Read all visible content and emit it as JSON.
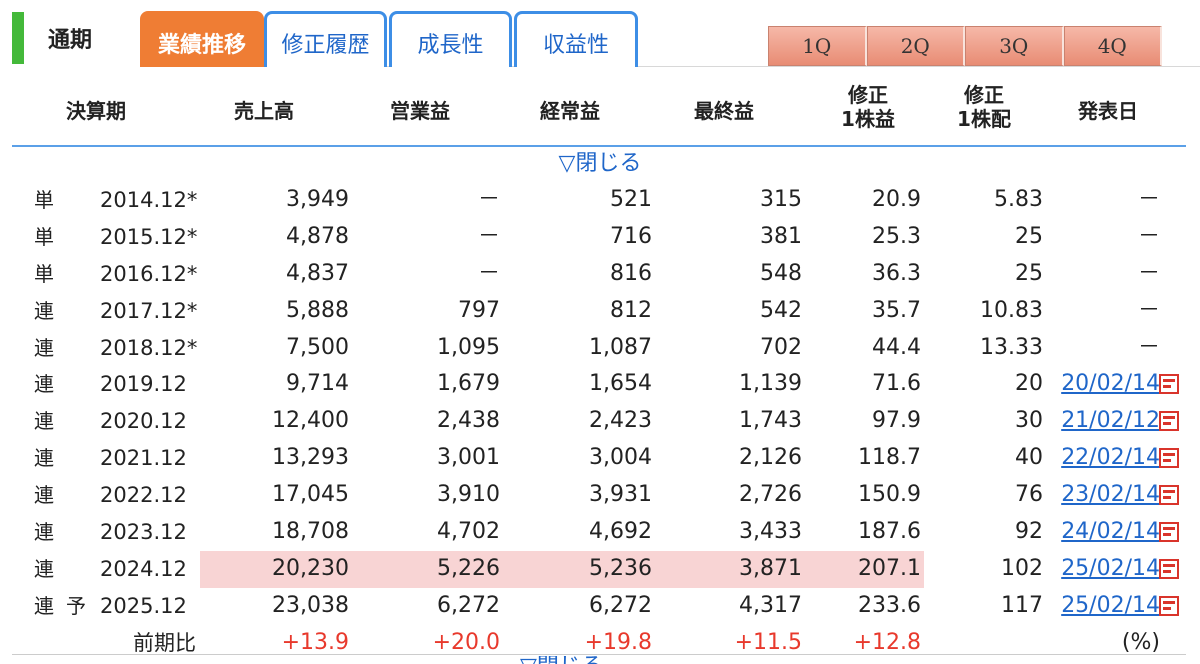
{
  "tabs": {
    "title": "通期",
    "items": [
      {
        "label": "業績推移",
        "active": true
      },
      {
        "label": "修正履歴",
        "active": false
      },
      {
        "label": "成長性",
        "active": false
      },
      {
        "label": "収益性",
        "active": false
      }
    ],
    "quarters": [
      "1Q",
      "2Q",
      "3Q",
      "4Q"
    ]
  },
  "header": {
    "period": "決算期",
    "sales": "売上高",
    "operating": "営業益",
    "ordinary": "経常益",
    "net": "最終益",
    "eps_l1": "修正",
    "eps_l2": "1株益",
    "div_l1": "修正",
    "div_l2": "1株配",
    "date": "発表日"
  },
  "toggle_label": "▽閉じる",
  "rows": [
    {
      "type": "単",
      "yoso": "",
      "period": "2014.12*",
      "sales": "3,949",
      "op": "－",
      "ord": "521",
      "net": "315",
      "eps": "20.9",
      "div": "5.83",
      "date": "－",
      "link": false,
      "hl": false
    },
    {
      "type": "単",
      "yoso": "",
      "period": "2015.12*",
      "sales": "4,878",
      "op": "－",
      "ord": "716",
      "net": "381",
      "eps": "25.3",
      "div": "25",
      "date": "－",
      "link": false,
      "hl": false
    },
    {
      "type": "単",
      "yoso": "",
      "period": "2016.12*",
      "sales": "4,837",
      "op": "－",
      "ord": "816",
      "net": "548",
      "eps": "36.3",
      "div": "25",
      "date": "－",
      "link": false,
      "hl": false
    },
    {
      "type": "連",
      "yoso": "",
      "period": "2017.12*",
      "sales": "5,888",
      "op": "797",
      "ord": "812",
      "net": "542",
      "eps": "35.7",
      "div": "10.83",
      "date": "－",
      "link": false,
      "hl": false
    },
    {
      "type": "連",
      "yoso": "",
      "period": "2018.12*",
      "sales": "7,500",
      "op": "1,095",
      "ord": "1,087",
      "net": "702",
      "eps": "44.4",
      "div": "13.33",
      "date": "－",
      "link": false,
      "hl": false
    },
    {
      "type": "連",
      "yoso": "",
      "period": "2019.12",
      "sales": "9,714",
      "op": "1,679",
      "ord": "1,654",
      "net": "1,139",
      "eps": "71.6",
      "div": "20",
      "date": "20/02/14",
      "link": true,
      "hl": false
    },
    {
      "type": "連",
      "yoso": "",
      "period": "2020.12",
      "sales": "12,400",
      "op": "2,438",
      "ord": "2,423",
      "net": "1,743",
      "eps": "97.9",
      "div": "30",
      "date": "21/02/12",
      "link": true,
      "hl": false
    },
    {
      "type": "連",
      "yoso": "",
      "period": "2021.12",
      "sales": "13,293",
      "op": "3,001",
      "ord": "3,004",
      "net": "2,126",
      "eps": "118.7",
      "div": "40",
      "date": "22/02/14",
      "link": true,
      "hl": false
    },
    {
      "type": "連",
      "yoso": "",
      "period": "2022.12",
      "sales": "17,045",
      "op": "3,910",
      "ord": "3,931",
      "net": "2,726",
      "eps": "150.9",
      "div": "76",
      "date": "23/02/14",
      "link": true,
      "hl": false
    },
    {
      "type": "連",
      "yoso": "",
      "period": "2023.12",
      "sales": "18,708",
      "op": "4,702",
      "ord": "4,692",
      "net": "3,433",
      "eps": "187.6",
      "div": "92",
      "date": "24/02/14",
      "link": true,
      "hl": false
    },
    {
      "type": "連",
      "yoso": "",
      "period": "2024.12",
      "sales": "20,230",
      "op": "5,226",
      "ord": "5,236",
      "net": "3,871",
      "eps": "207.1",
      "div": "102",
      "date": "25/02/14",
      "link": true,
      "hl": true
    },
    {
      "type": "連",
      "yoso": "予",
      "period": "2025.12",
      "sales": "23,038",
      "op": "6,272",
      "ord": "6,272",
      "net": "4,317",
      "eps": "233.6",
      "div": "117",
      "date": "25/02/14",
      "link": true,
      "hl": false
    }
  ],
  "change_row": {
    "label": "前期比",
    "sales": "+13.9",
    "op": "+20.0",
    "ord": "+19.8",
    "net": "+11.5",
    "eps": "+12.8",
    "unit": "(%)"
  },
  "colors": {
    "active_tab": "#ef7d34",
    "tab_border": "#3d8ee6",
    "highlight": "#f8d4d4",
    "positive": "#e8392c",
    "link": "#1f66c9"
  }
}
